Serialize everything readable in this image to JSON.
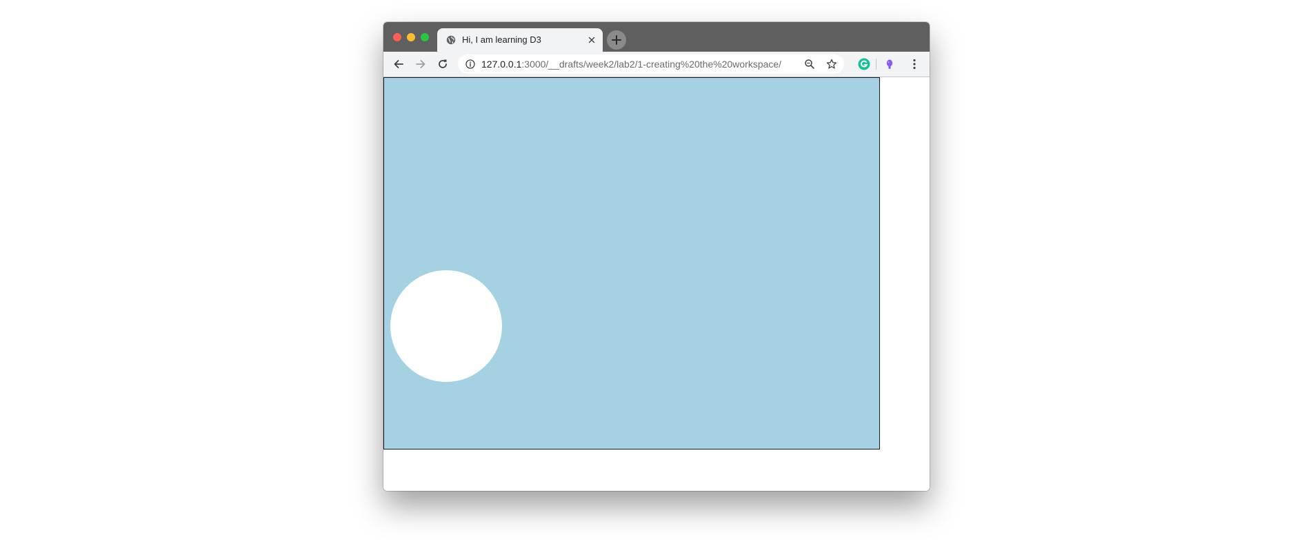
{
  "browser": {
    "tab": {
      "title": "Hi, I am learning D3",
      "favicon": "globe-icon"
    },
    "address_bar": {
      "host": "127.0.0.1",
      "path": ":3000/__drafts/week2/lab2/1-creating%20the%20workspace/"
    },
    "icons": {
      "back": "back-arrow-icon",
      "forward": "forward-arrow-icon",
      "reload": "reload-icon",
      "info": "info-icon",
      "zoom": "zoom-out-icon",
      "bookmark": "star-icon",
      "grammarly": "grammarly-icon",
      "extension": "extension-icon",
      "menu": "kebab-menu-icon"
    },
    "colors": {
      "titlebar": "#5f5f5f",
      "toolbar": "#f1f3f4",
      "grammarly": "#15c39a",
      "extension": "#8a5cf5"
    }
  },
  "page": {
    "workspace": {
      "background": "#a5d2e3",
      "border": "#1a1a1a",
      "circle_fill": "#ffffff"
    }
  }
}
